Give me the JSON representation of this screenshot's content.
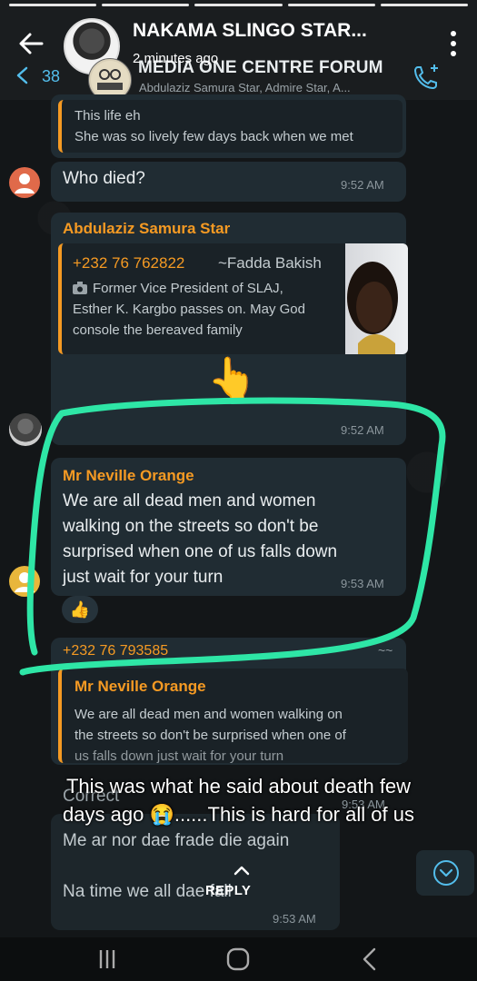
{
  "status": {
    "contact_name": "NAKAMA SLINGO STAR...",
    "time_ago": "2 minutes ago",
    "caption_line1": "This was what he said about death few",
    "caption_line2_before": "days ago ",
    "caption_emoji": "😭",
    "caption_line2_after": "......This is hard for all of us",
    "reply_label": "REPLY"
  },
  "chat_header": {
    "unread_count": "38",
    "group_title": "MEDIA ONE CENTRE FORUM",
    "members": "Abdulaziz Samura Star, Admire Star, A..."
  },
  "messages": {
    "m0": {
      "quote_line1": "This life eh",
      "quote_line2": "She was so lively few days back when we met"
    },
    "m1": {
      "text": "Who died?",
      "time": "9:52 AM"
    },
    "m2": {
      "sender": "Abdulaziz Samura Star",
      "quote_phone": "+232 76 762822",
      "quote_name": "~Fadda Bakish",
      "quote_line1": "Former Vice President of SLAJ,",
      "quote_line2": "Esther K. Kargbo passes on. May God",
      "quote_line3": "console the bereaved family",
      "time": "9:52 AM"
    },
    "m3": {
      "sender": "Mr Neville Orange",
      "line1": "We are all dead men and women",
      "line2": "walking on the streets so don't be",
      "line3": "surprised when one of us falls down",
      "line4": "just wait for your turn",
      "time": "9:53 AM",
      "reaction": "👍"
    },
    "m4": {
      "sender_phone": "+232 76 793585",
      "sender_name": "~~",
      "quote_sender": "Mr Neville Orange",
      "quote_line1": "We are all dead men and women walking on",
      "quote_line2": "the streets so don't be surprised when one of",
      "quote_line3": "us falls down just wait for your turn",
      "text": "Correct",
      "time": "9:53 AM"
    },
    "m5": {
      "line1": "Me ar nor dae frade die again",
      "line2": "Na time we all dae fall",
      "time": "9:53 AM"
    }
  },
  "colors": {
    "accent_orange": "#f59a23",
    "highlight_green": "#2ee6a6",
    "link_blue": "#53bdeb"
  },
  "icons": {
    "hand_emoji": "👆"
  }
}
